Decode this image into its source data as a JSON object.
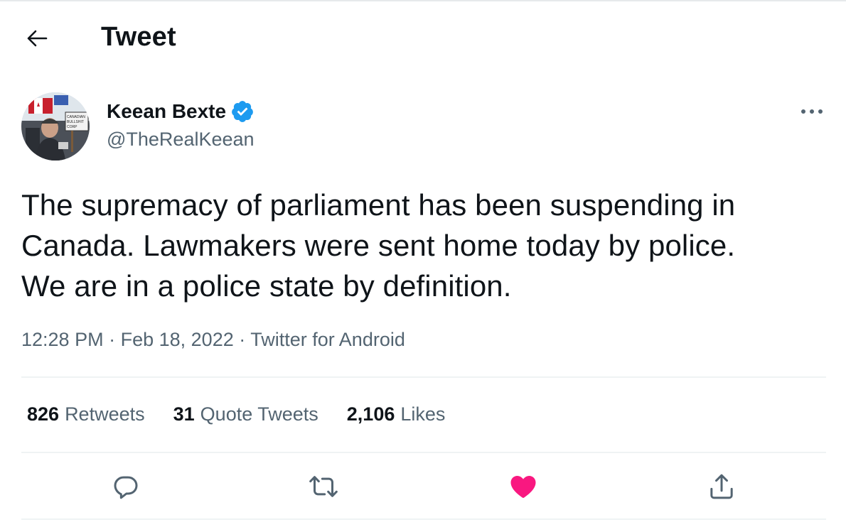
{
  "header": {
    "title": "Tweet",
    "back_icon": "back-arrow-icon"
  },
  "author": {
    "name": "Keean Bexte",
    "handle": "@TheRealKeean",
    "verified": true,
    "avatar_sign_text": "CANADIAN BULLSHIT CORP"
  },
  "tweet": {
    "lines": [
      "The supremacy of parliament has been suspending in",
      "Canada. Lawmakers were sent home today by police.",
      "We are in a police state by definition."
    ],
    "time": "12:28 PM",
    "separator": "·",
    "date": "Feb 18, 2022",
    "source": "Twitter for Android"
  },
  "stats": {
    "retweets": {
      "count": "826",
      "label": "Retweets"
    },
    "quote_tweets": {
      "count": "31",
      "label": "Quote Tweets"
    },
    "likes": {
      "count": "2,106",
      "label": "Likes"
    }
  },
  "actions": {
    "reply_icon": "reply-icon",
    "retweet_icon": "retweet-icon",
    "like_icon": "heart-icon",
    "like_state": "liked",
    "share_icon": "share-icon"
  },
  "colors": {
    "verified": "#1d9bf0",
    "like": "#f91880",
    "secondary_text": "#536471",
    "primary_text": "#0f1419"
  }
}
